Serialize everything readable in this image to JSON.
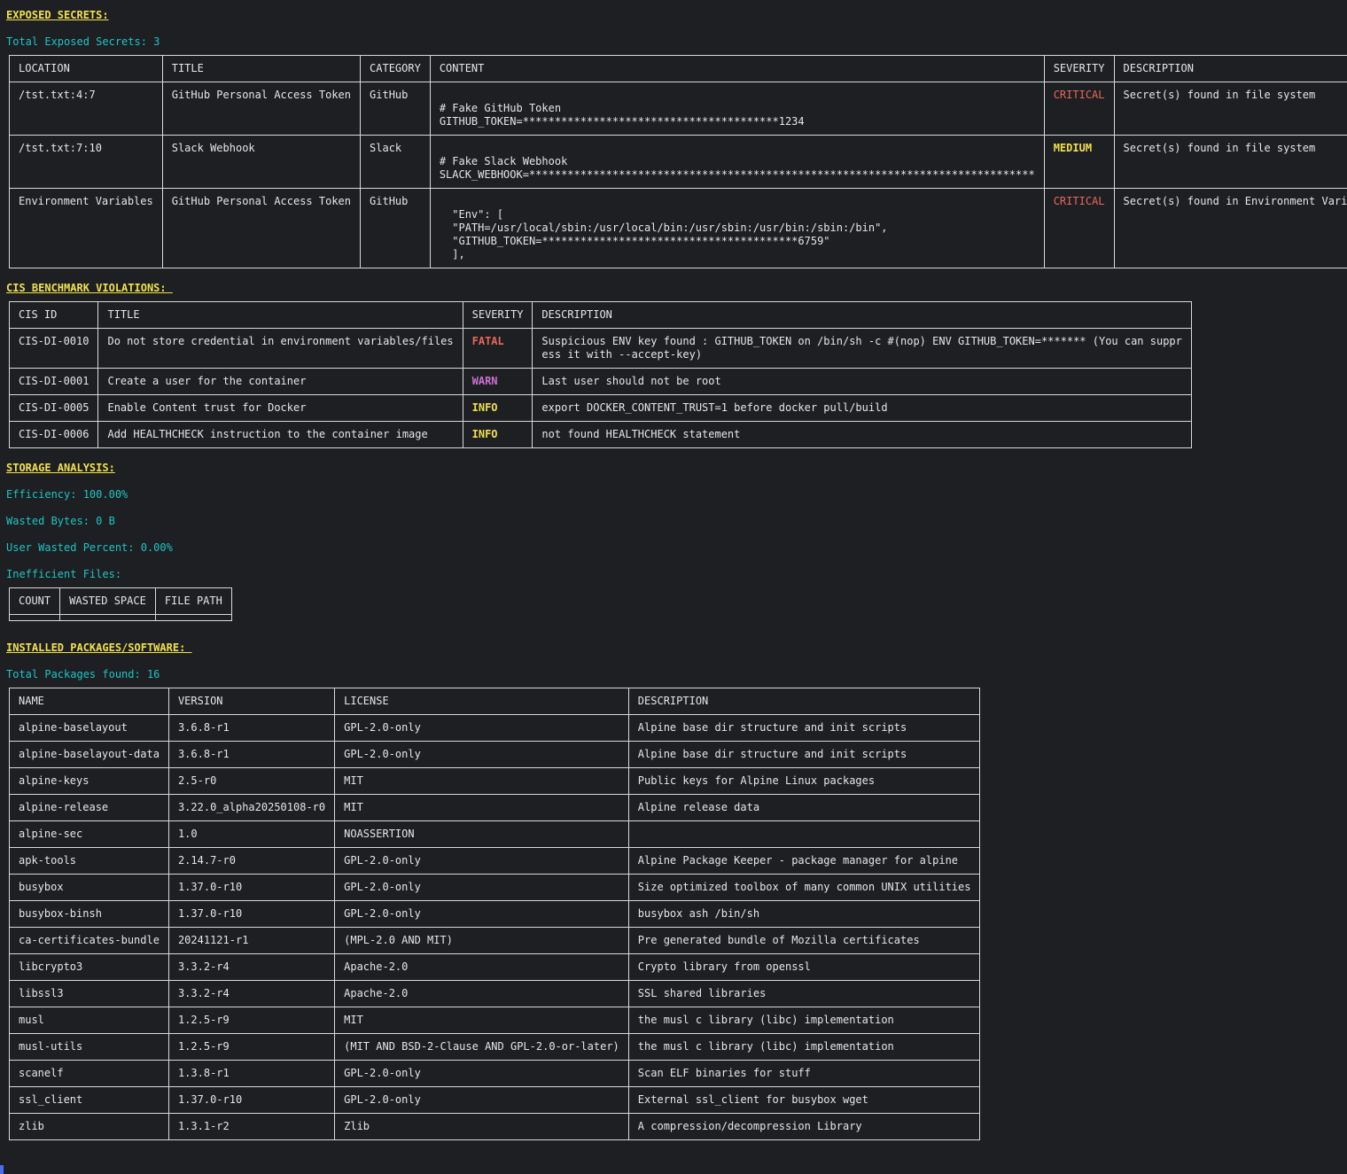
{
  "secrets": {
    "title": "EXPOSED SECRETS:",
    "total": "Total Exposed Secrets: 3",
    "headers": [
      "LOCATION",
      "TITLE",
      "CATEGORY",
      "CONTENT",
      "SEVERITY",
      "DESCRIPTION"
    ],
    "rows": [
      {
        "location": "/tst.txt:4:7",
        "title": "GitHub Personal Access Token",
        "category": "GitHub",
        "content": "\n# Fake GitHub Token\nGITHUB_TOKEN=****************************************1234",
        "severity": "CRITICAL",
        "description": "Secret(s) found in file system"
      },
      {
        "location": "/tst.txt:7:10",
        "title": "Slack Webhook",
        "category": "Slack",
        "content": "\n# Fake Slack Webhook\nSLACK_WEBHOOK=*******************************************************************************",
        "severity": "MEDIUM",
        "description": "Secret(s) found in file system"
      },
      {
        "location": "Environment Variables",
        "title": "GitHub Personal Access Token",
        "category": "GitHub",
        "content": "\n  \"Env\": [\n  \"PATH=/usr/local/sbin:/usr/local/bin:/usr/sbin:/usr/bin:/sbin:/bin\",\n  \"GITHUB_TOKEN=****************************************6759\"\n  ],",
        "severity": "CRITICAL",
        "description": "Secret(s) found in Environment Variables"
      }
    ]
  },
  "cis": {
    "title": "CIS BENCHMARK VIOLATIONS: ",
    "headers": [
      "CIS ID",
      "TITLE",
      "SEVERITY",
      "DESCRIPTION"
    ],
    "rows": [
      {
        "id": "CIS-DI-0010",
        "title": "Do not store credential in environment variables/files",
        "severity": "FATAL",
        "description": "Suspicious ENV key found : GITHUB_TOKEN on /bin/sh -c #(nop) ENV GITHUB_TOKEN=******* (You can suppr\ness it with --accept-key)"
      },
      {
        "id": "CIS-DI-0001",
        "title": "Create a user for the container",
        "severity": "WARN",
        "description": "Last user should not be root"
      },
      {
        "id": "CIS-DI-0005",
        "title": "Enable Content trust for Docker",
        "severity": "INFO",
        "description": "export DOCKER_CONTENT_TRUST=1 before docker pull/build"
      },
      {
        "id": "CIS-DI-0006",
        "title": "Add HEALTHCHECK instruction to the container image",
        "severity": "INFO",
        "description": "not found HEALTHCHECK statement"
      }
    ]
  },
  "storage": {
    "title": "STORAGE ANALYSIS:",
    "efficiency": "Efficiency: 100.00%",
    "wasted_bytes": "Wasted Bytes: 0 B",
    "user_wasted": "User Wasted Percent: 0.00%",
    "inefficient_label": "Inefficient Files:",
    "headers": [
      "COUNT",
      "WASTED SPACE",
      "FILE PATH"
    ]
  },
  "packages": {
    "title": "INSTALLED PACKAGES/SOFTWARE: ",
    "total": "Total Packages found: 16",
    "headers": [
      "NAME",
      "VERSION",
      "LICENSE",
      "DESCRIPTION"
    ],
    "rows": [
      [
        "alpine-baselayout",
        "3.6.8-r1",
        "GPL-2.0-only",
        "Alpine base dir structure and init scripts"
      ],
      [
        "alpine-baselayout-data",
        "3.6.8-r1",
        "GPL-2.0-only",
        "Alpine base dir structure and init scripts"
      ],
      [
        "alpine-keys",
        "2.5-r0",
        "MIT",
        "Public keys for Alpine Linux packages"
      ],
      [
        "alpine-release",
        "3.22.0_alpha20250108-r0",
        "MIT",
        "Alpine release data"
      ],
      [
        "alpine-sec",
        "1.0",
        "NOASSERTION",
        ""
      ],
      [
        "apk-tools",
        "2.14.7-r0",
        "GPL-2.0-only",
        "Alpine Package Keeper - package manager for alpine"
      ],
      [
        "busybox",
        "1.37.0-r10",
        "GPL-2.0-only",
        "Size optimized toolbox of many common UNIX utilities"
      ],
      [
        "busybox-binsh",
        "1.37.0-r10",
        "GPL-2.0-only",
        "busybox ash /bin/sh"
      ],
      [
        "ca-certificates-bundle",
        "20241121-r1",
        "(MPL-2.0 AND MIT)",
        "Pre generated bundle of Mozilla certificates"
      ],
      [
        "libcrypto3",
        "3.3.2-r4",
        "Apache-2.0",
        "Crypto library from openssl"
      ],
      [
        "libssl3",
        "3.3.2-r4",
        "Apache-2.0",
        "SSL shared libraries"
      ],
      [
        "musl",
        "1.2.5-r9",
        "MIT",
        "the musl c library (libc) implementation"
      ],
      [
        "musl-utils",
        "1.2.5-r9",
        "(MIT AND BSD-2-Clause AND GPL-2.0-or-later)",
        "the musl c library (libc) implementation"
      ],
      [
        "scanelf",
        "1.3.8-r1",
        "GPL-2.0-only",
        "Scan ELF binaries for stuff"
      ],
      [
        "ssl_client",
        "1.37.0-r10",
        "GPL-2.0-only",
        "External ssl_client for busybox wget"
      ],
      [
        "zlib",
        "1.3.1-r2",
        "Zlib",
        "A compression/decompression Library"
      ]
    ]
  },
  "colors": {
    "background": "#1d1f23",
    "section": "#f2e04b",
    "info": "#1fc4c4",
    "critical": "#e8675a",
    "warn": "#d070d8"
  }
}
